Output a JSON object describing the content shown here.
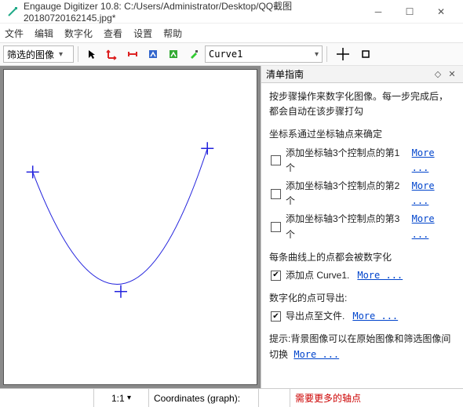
{
  "title": "Engauge Digitizer 10.8: C:/Users/Administrator/Desktop/QQ截图20180720162145.jpg*",
  "menu": {
    "file": "文件",
    "edit": "编辑",
    "digitize": "数字化",
    "view": "查看",
    "settings": "设置",
    "help": "帮助"
  },
  "toolbar": {
    "filterCombo": "筛选的图像",
    "curveCombo": "Curve1"
  },
  "guide": {
    "title": "清单指南",
    "intro": "按步骤操作来数字化图像。每一步完成后，都会自动在该步骤打勾",
    "axisTitle": "坐标系通过坐标轴点来确定",
    "axis1": "添加坐标轴3个控制点的第1个",
    "axis2": "添加坐标轴3个控制点的第2个",
    "axis3": "添加坐标轴3个控制点的第3个",
    "curveTitle": "每条曲线上的点都会被数字化",
    "curveAdd": "添加点 Curve1.",
    "exportTitle": "数字化的点可导出:",
    "exportDo": "导出点至文件.",
    "hint": "提示:背景图像可以在原始图像和筛选图像间切换",
    "more": "More ..."
  },
  "status": {
    "zoom": "1:1",
    "coordLabel": "Coordinates (graph):",
    "msg": "需要更多的轴点"
  }
}
